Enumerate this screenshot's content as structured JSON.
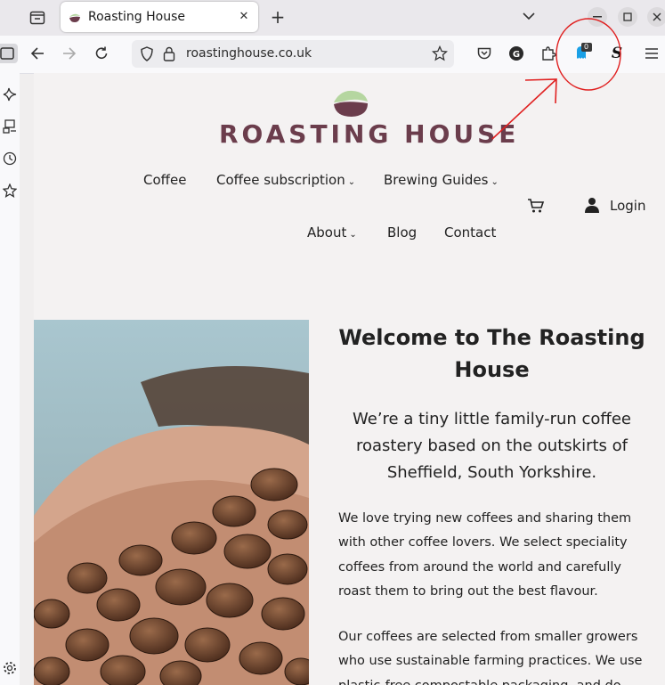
{
  "browser": {
    "tab_title": "Roasting House",
    "url": "roastinghouse.co.uk",
    "extension_badge": "0",
    "new_tab_label": "+",
    "close_tab_label": "✕"
  },
  "site": {
    "logo_text": "ROASTING HOUSE",
    "nav": {
      "coffee": "Coffee",
      "subscription": "Coffee subscription",
      "guides": "Brewing Guides",
      "about": "About",
      "blog": "Blog",
      "contact": "Contact",
      "login": "Login"
    },
    "heading": "Welcome to The Roasting House",
    "lead": "We’re a tiny little family-run coffee roastery based on the outskirts of Sheffield, South Yorkshire.",
    "para1": "We love trying new coffees and sharing them with other coffee lovers. We select speciality coffees from around the world and carefully roast them to bring out the best flavour.",
    "para2": "Our coffees are selected from smaller growers who use sustainable farming practices. We use plastic-free compostable packaging, and do"
  },
  "colors": {
    "brand": "#6b3d4c",
    "logo_green": "#b5d6a0",
    "annotation": "#e02020"
  }
}
